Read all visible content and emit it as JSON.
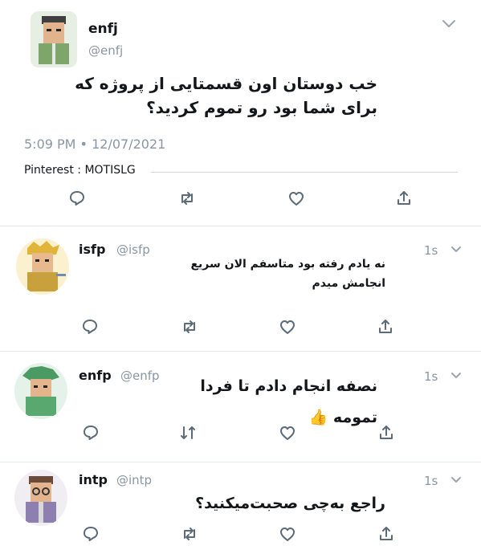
{
  "main_tweet": {
    "name": "enfj",
    "handle": "@enfj",
    "text_line1": "خب دوستان اون قسمتایی از پروژه که",
    "text_line2": "برای شما بود رو تموم کردید؟",
    "timestamp": "5:09 PM • 12/07/2021",
    "source": "Pinterest : MOTISLG"
  },
  "replies": [
    {
      "name": "isfp",
      "handle": "@isfp",
      "time": "1s",
      "line1": "نه یادم رفته بود متاسفم الان سریع",
      "line2": "انجامش میدم"
    },
    {
      "name": "enfp",
      "handle": "@enfp",
      "time": "1s",
      "line1": "نصفه انجام دادم تا فردا",
      "line2": "تمومه",
      "emoji": "👍"
    },
    {
      "name": "intp",
      "handle": "@intp",
      "time": "1s",
      "line1": "راجع به‌چی صحبت‌میکنید؟"
    }
  ],
  "colors": {
    "text": "#14171a",
    "muted": "#8a96a3",
    "divider": "#e1e8ed",
    "icon": "#5b6b79"
  },
  "icons": [
    "reply-icon",
    "retweet-icon",
    "like-icon",
    "share-icon",
    "chevron-down-icon"
  ]
}
